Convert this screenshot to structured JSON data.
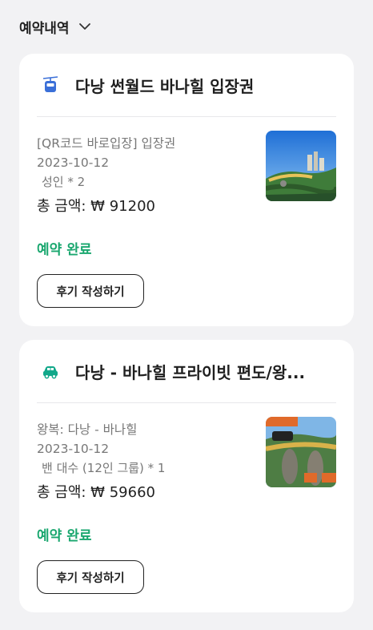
{
  "header": {
    "title": "예약내역",
    "icon": "chevron-down-icon"
  },
  "orders": [
    {
      "category_icon": "cable-car-icon",
      "title": "다낭 썬월드 바나힐 입장권",
      "option": "[QR코드 바로입장] 입장권",
      "date": "2023-10-12",
      "quantity": "성인 * 2",
      "total": "총 금액: ₩ 91200",
      "status": "예약 완료",
      "review_button": "후기 작성하기"
    },
    {
      "category_icon": "car-icon",
      "title": "다낭 - 바나힐 프라이빗 편도/왕...",
      "option": "왕복: 다낭 - 바나힐",
      "date": "2023-10-12",
      "quantity": "밴 대수 (12인 그룹) * 1",
      "total": "총 금액: ₩ 59660",
      "status": "예약 완료",
      "review_button": "후기 작성하기"
    }
  ],
  "colors": {
    "status": "#1aa76f",
    "cable_car_icon": "#3a6fd8",
    "car_icon": "#11a88a"
  }
}
